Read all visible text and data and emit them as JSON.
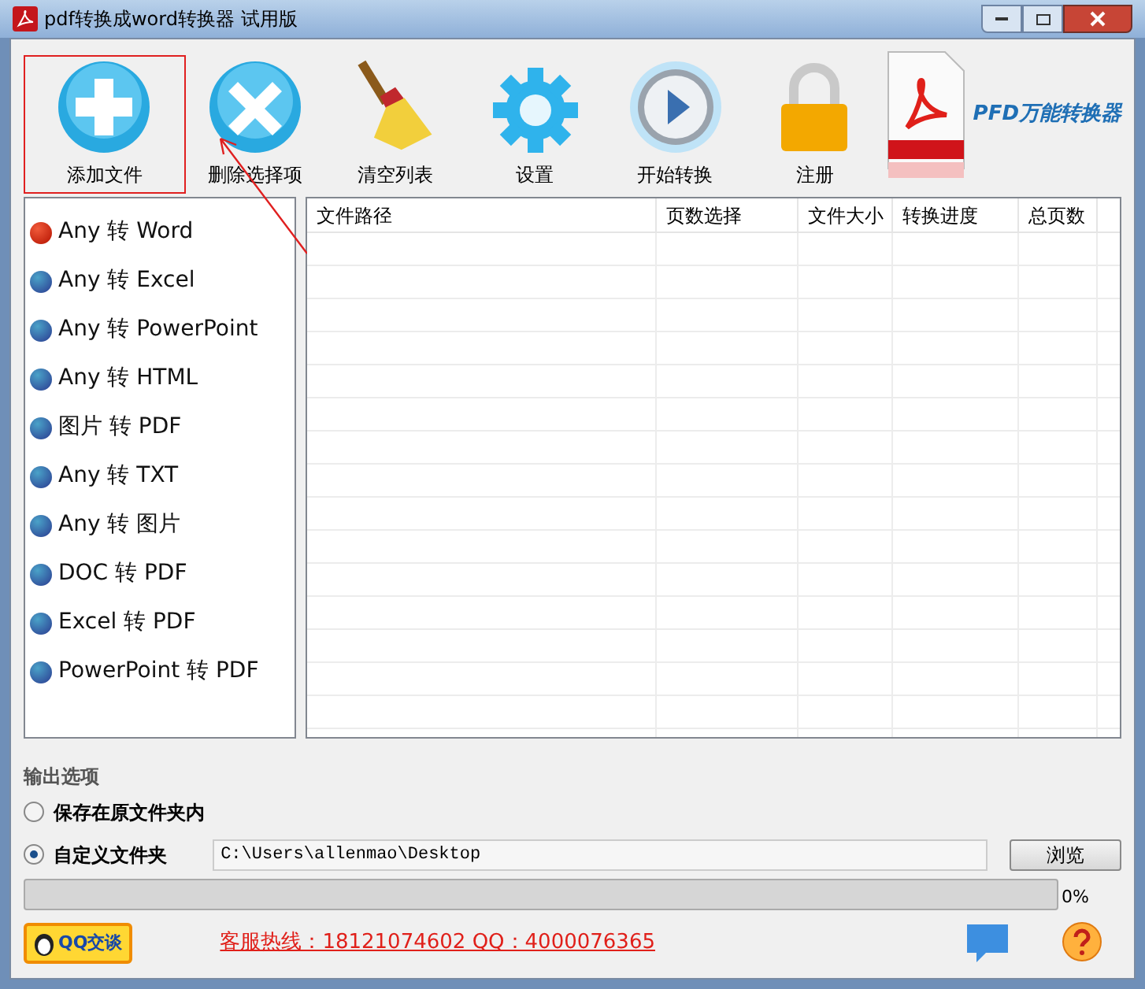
{
  "window": {
    "title": "pdf转换成word转换器 试用版"
  },
  "toolbar": [
    {
      "kind": "add",
      "label": "添加文件",
      "highlighted": true
    },
    {
      "kind": "delete",
      "label": "删除选择项",
      "highlighted": false
    },
    {
      "kind": "broom",
      "label": "清空列表",
      "highlighted": false
    },
    {
      "kind": "gear",
      "label": "设置",
      "highlighted": false
    },
    {
      "kind": "play",
      "label": "开始转换",
      "highlighted": false
    },
    {
      "kind": "lock",
      "label": "注册",
      "highlighted": false
    }
  ],
  "brand": {
    "label": "PFD万能转换器"
  },
  "modes": [
    {
      "label": "Any 转 Word",
      "selected": true
    },
    {
      "label": "Any 转 Excel",
      "selected": false
    },
    {
      "label": "Any 转 PowerPoint",
      "selected": false
    },
    {
      "label": "Any 转 HTML",
      "selected": false
    },
    {
      "label": "图片 转 PDF",
      "selected": false
    },
    {
      "label": "Any 转 TXT",
      "selected": false
    },
    {
      "label": "Any 转 图片",
      "selected": false
    },
    {
      "label": "DOC 转 PDF",
      "selected": false
    },
    {
      "label": "Excel 转 PDF",
      "selected": false
    },
    {
      "label": "PowerPoint 转 PDF",
      "selected": false
    }
  ],
  "table": {
    "columns": [
      "文件路径",
      "页数选择",
      "文件大小",
      "转换进度",
      "总页数"
    ]
  },
  "output": {
    "title": "输出选项",
    "options": [
      {
        "label": "保存在原文件夹内",
        "selected": false
      },
      {
        "label": "自定义文件夹",
        "selected": true
      }
    ],
    "path": "C:\\Users\\allenmao\\Desktop",
    "browse": "浏览"
  },
  "progress": {
    "level": 0,
    "reading": "0%"
  },
  "footer": {
    "qq": "QQ交谈",
    "hotline": "客服热线：18121074602 QQ：4000076365"
  }
}
